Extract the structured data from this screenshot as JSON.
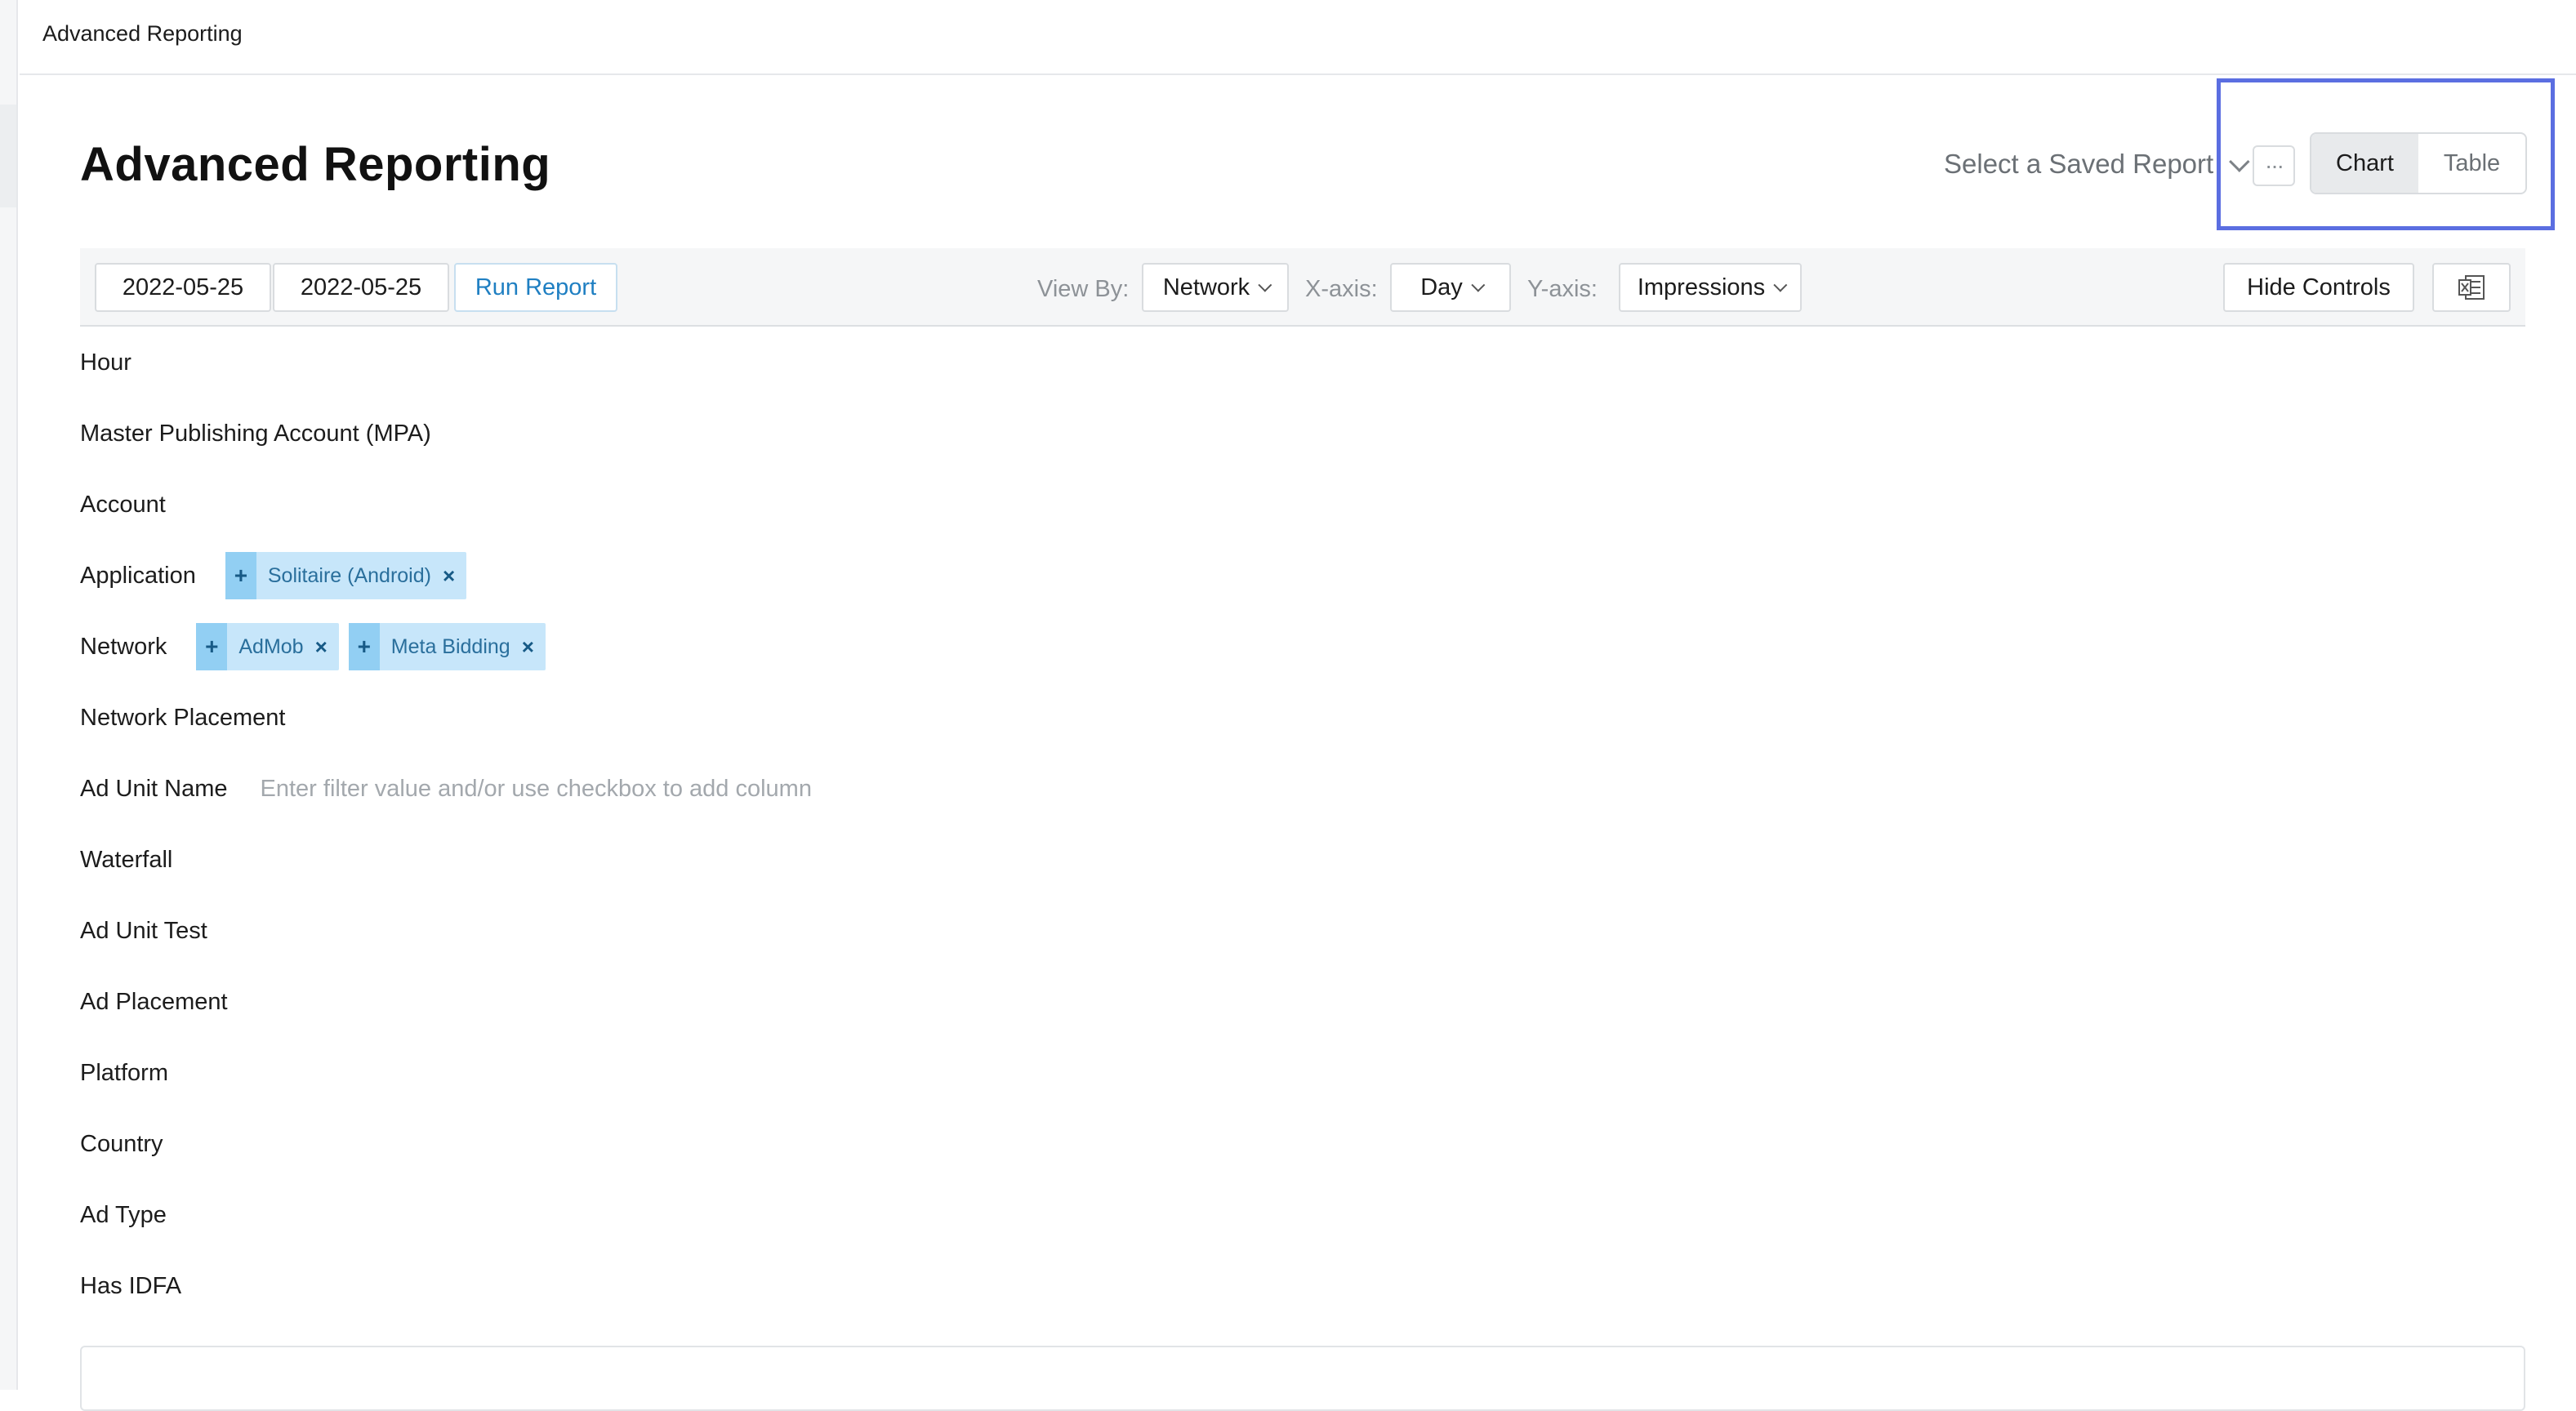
{
  "topbar": {
    "breadcrumb": "Advanced Reporting"
  },
  "page": {
    "title": "Advanced Reporting"
  },
  "saved_report": {
    "label": "Select a Saved Report",
    "more_label": "···"
  },
  "view_toggle": {
    "chart_label": "Chart",
    "table_label": "Table",
    "active": "Chart"
  },
  "controls": {
    "start_date": "2022-05-25",
    "end_date": "2022-05-25",
    "run_label": "Run Report",
    "view_by_label": "View By:",
    "view_by_value": "Network",
    "x_axis_label": "X-axis:",
    "x_axis_value": "Day",
    "y_axis_label": "Y-axis:",
    "y_axis_value": "Impressions",
    "hide_controls_label": "Hide Controls",
    "export_icon": "excel-export-icon"
  },
  "filters": {
    "hour": "Hour",
    "mpa": "Master Publishing Account (MPA)",
    "account": "Account",
    "application": "Application",
    "application_chips": [
      "Solitaire (Android)"
    ],
    "network": "Network",
    "network_chips": [
      "AdMob",
      "Meta Bidding"
    ],
    "network_placement": "Network Placement",
    "ad_unit_name": "Ad Unit Name",
    "ad_unit_placeholder": "Enter filter value and/or use checkbox to add column",
    "waterfall": "Waterfall",
    "ad_unit_test": "Ad Unit Test",
    "ad_placement": "Ad Placement",
    "platform": "Platform",
    "country": "Country",
    "ad_type": "Ad Type",
    "has_idfa": "Has IDFA"
  },
  "chip_symbols": {
    "add": "+",
    "remove": "×"
  },
  "colors": {
    "chip_bg": "#c7e6fa",
    "chip_accent": "#92cff3",
    "link_blue": "#1f7fc2",
    "highlight": "#5b6ee1"
  }
}
